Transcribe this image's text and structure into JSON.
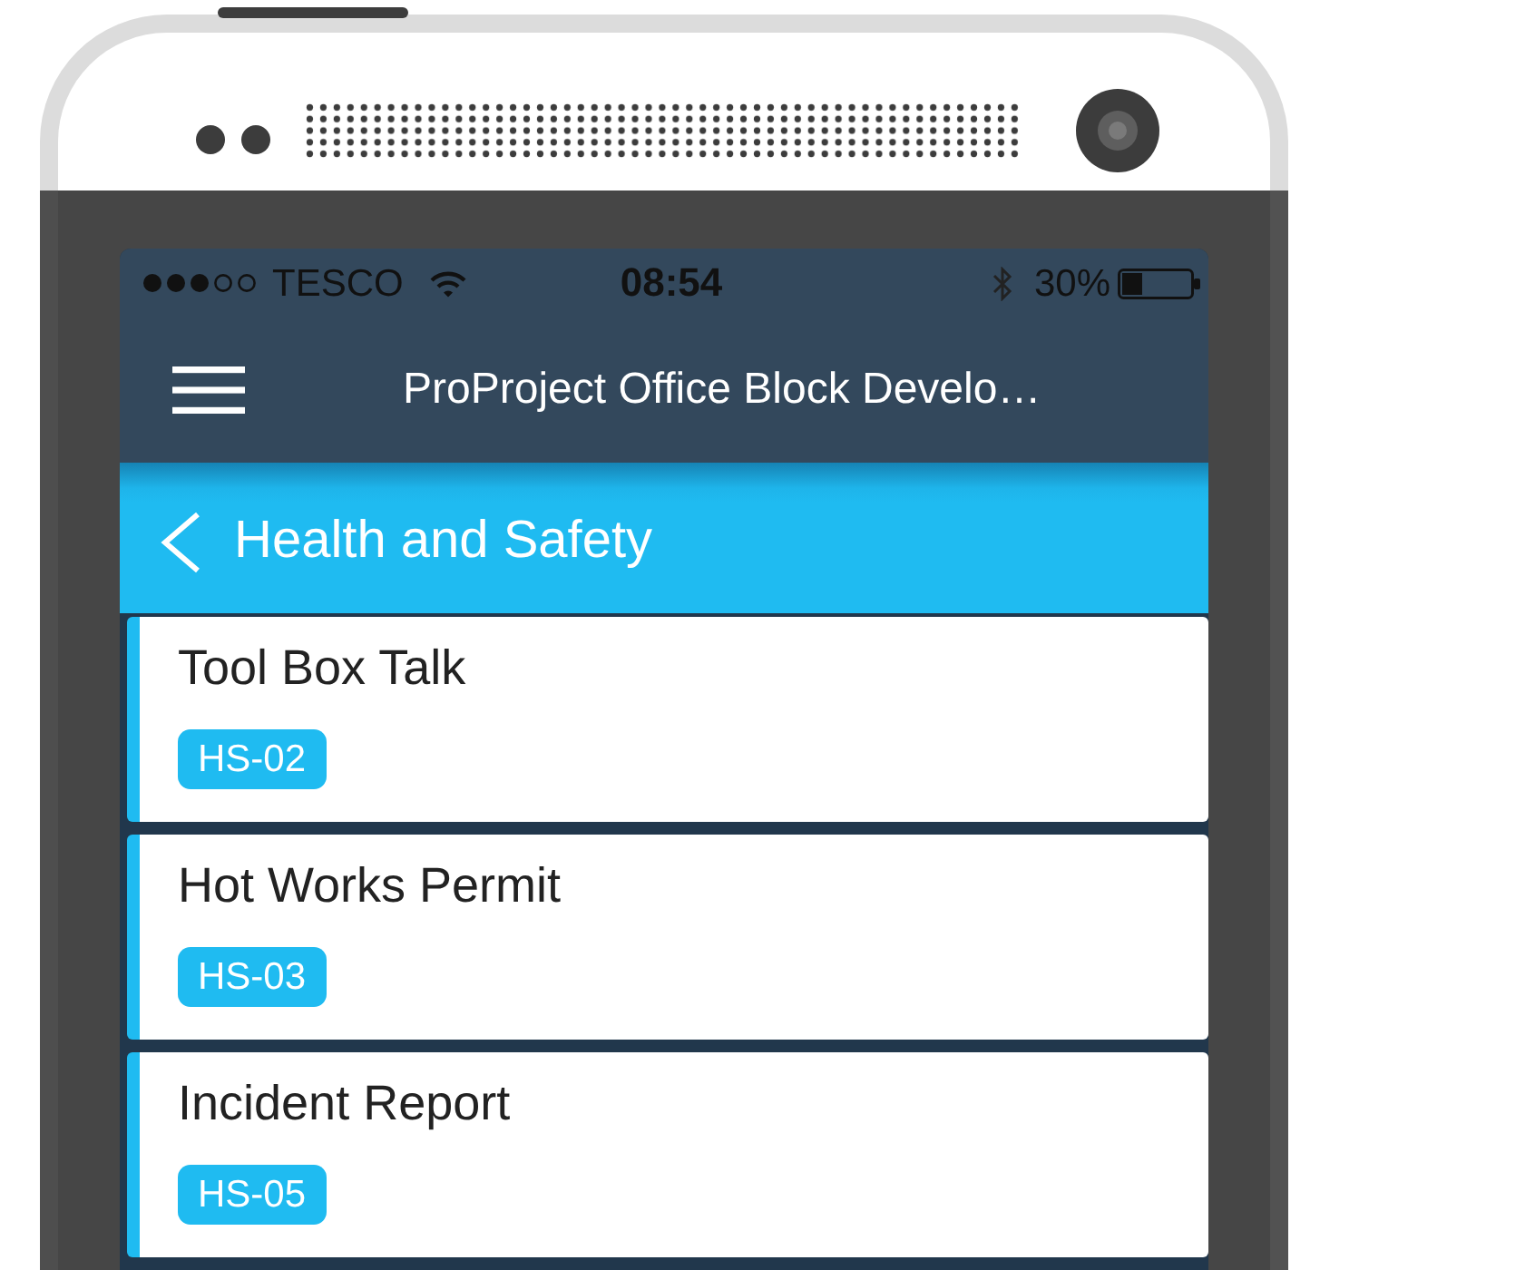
{
  "status_bar": {
    "carrier": "TESCO",
    "time": "08:54",
    "battery": "30%"
  },
  "nav_bar": {
    "title": "ProProject Office Block Develo…"
  },
  "section_header": {
    "title": "Health and Safety"
  },
  "items": [
    {
      "title": "Tool Box Talk",
      "code": "HS-02"
    },
    {
      "title": "Hot Works Permit",
      "code": "HS-03"
    },
    {
      "title": "Incident Report",
      "code": "HS-05"
    }
  ]
}
